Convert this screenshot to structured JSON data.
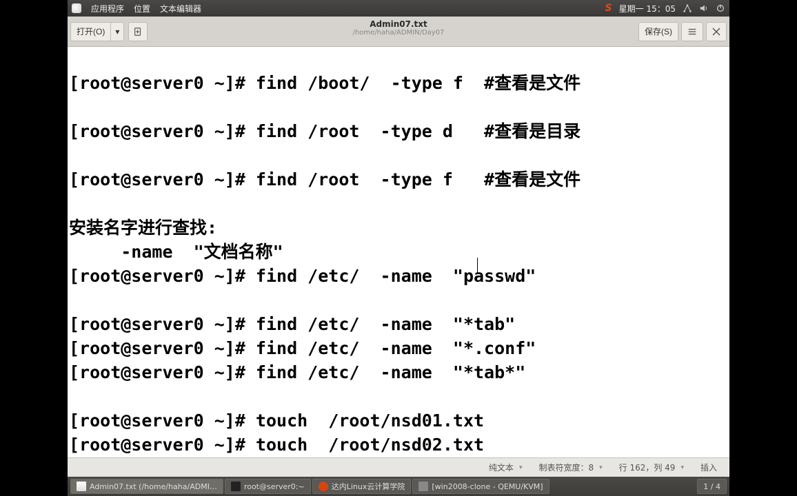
{
  "topbar": {
    "menus": [
      "应用程序",
      "位置",
      "文本编辑器"
    ],
    "clock": "星期一 15：05"
  },
  "chrome": {
    "open_label": "打开(O)",
    "save_label": "保存(S)",
    "title": "Admin07.txt",
    "path": "/home/haha/ADMIN/Day07"
  },
  "editor": {
    "content": "\n[root@server0 ~]# find /boot/  -type f  #查看是文件\n\n[root@server0 ~]# find /root  -type d   #查看是目录\n\n[root@server0 ~]# find /root  -type f   #查看是文件\n\n安装名字进行查找:\n     -name  \"文档名称\"\n[root@server0 ~]# find /etc/  -name  \"passwd\"\n\n[root@server0 ~]# find /etc/  -name  \"*tab\"\n[root@server0 ~]# find /etc/  -name  \"*.conf\"\n[root@server0 ~]# find /etc/  -name  \"*tab*\"\n\n[root@server0 ~]# touch  /root/nsd01.txt\n[root@server0 ~]# touch  /root/nsd02.txt"
  },
  "statusbar": {
    "plain_text": "纯文本",
    "tab_width": "制表符宽度：8",
    "cursor": "行 162，列 49",
    "mode": "插入"
  },
  "taskbar": {
    "items": [
      "Admin07.txt (/home/haha/ADMI…",
      "root@server0:~",
      "达内Linux云计算学院",
      "[win2008-clone - QEMU/KVM]"
    ],
    "pages": "1 / 4"
  }
}
